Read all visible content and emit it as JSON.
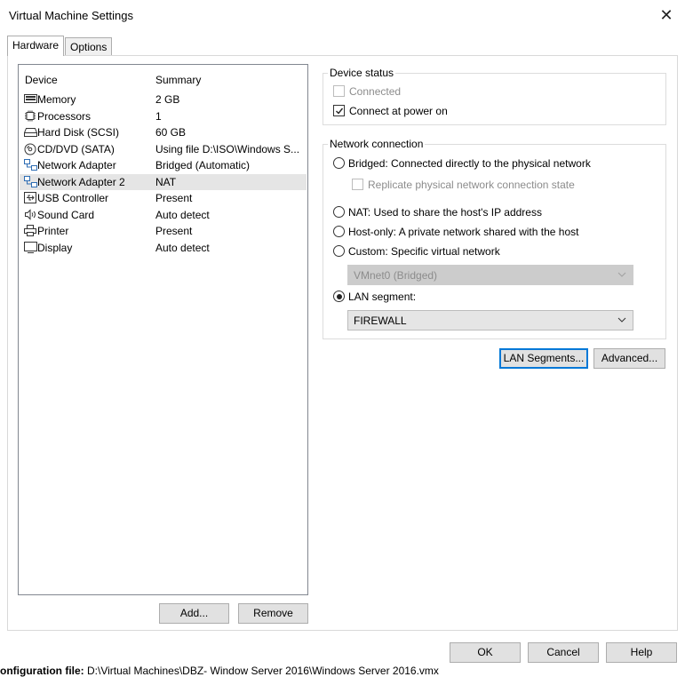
{
  "window": {
    "title": "Virtual Machine Settings",
    "close_glyph": "✕"
  },
  "tabs": [
    {
      "label": "Hardware"
    },
    {
      "label": "Options"
    }
  ],
  "device_table": {
    "headers": {
      "device": "Device",
      "summary": "Summary"
    },
    "rows": [
      {
        "name": "Memory",
        "summary": "2 GB",
        "icon": "memory-icon"
      },
      {
        "name": "Processors",
        "summary": "1",
        "icon": "processor-icon"
      },
      {
        "name": "Hard Disk (SCSI)",
        "summary": "60 GB",
        "icon": "hard-disk-icon"
      },
      {
        "name": "CD/DVD (SATA)",
        "summary": "Using file D:\\ISO\\Windows S...",
        "icon": "cd-dvd-icon"
      },
      {
        "name": "Network Adapter",
        "summary": "Bridged (Automatic)",
        "icon": "network-adapter-icon"
      },
      {
        "name": "Network Adapter 2",
        "summary": "NAT",
        "icon": "network-adapter-icon",
        "selected": true
      },
      {
        "name": "USB Controller",
        "summary": "Present",
        "icon": "usb-icon"
      },
      {
        "name": "Sound Card",
        "summary": "Auto detect",
        "icon": "speaker-icon"
      },
      {
        "name": "Printer",
        "summary": "Present",
        "icon": "printer-icon"
      },
      {
        "name": "Display",
        "summary": "Auto detect",
        "icon": "monitor-icon"
      }
    ],
    "add_label": "Add...",
    "remove_label": "Remove"
  },
  "device_status": {
    "title": "Device status",
    "connected": {
      "label": "Connected",
      "checked": false,
      "disabled": true
    },
    "connect_at_power_on": {
      "label": "Connect at power on",
      "checked": true
    }
  },
  "network_connection": {
    "title": "Network connection",
    "bridged": "Bridged: Connected directly to the physical network",
    "replicate": "Replicate physical network connection state",
    "nat": "NAT: Used to share the host's IP address",
    "host_only": "Host-only: A private network shared with the host",
    "custom": "Custom: Specific virtual network",
    "custom_value": "VMnet0 (Bridged)",
    "lan_segment": "LAN segment:",
    "lan_segment_value": "FIREWALL",
    "selected": "lan_segment"
  },
  "actions": {
    "lan_segments": "LAN Segments...",
    "advanced": "Advanced..."
  },
  "footer": {
    "config_label": "onfiguration file:",
    "config_path": "D:\\Virtual Machines\\DBZ- Window Server 2016\\Windows Server 2016.vmx",
    "ok": "OK",
    "cancel": "Cancel",
    "help": "Help"
  },
  "colors": {
    "selection": "#e5e5e5",
    "focus": "#0078d7",
    "button": "#e1e1e1"
  }
}
